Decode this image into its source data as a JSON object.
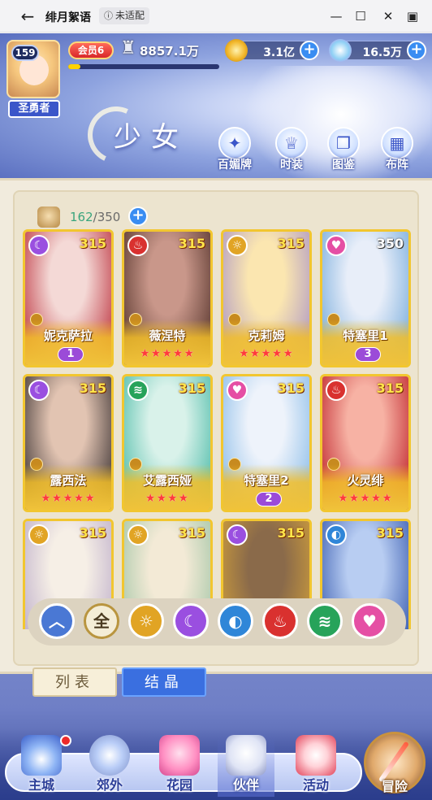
{
  "window": {
    "title": "绯月絮语",
    "badge": "未适配",
    "back_icon": "back-arrow-icon"
  },
  "player": {
    "level": "159",
    "title_tag": "圣勇者",
    "vip": "会员6",
    "power": "8857.1万",
    "exp_progress": 0.08
  },
  "resources": [
    {
      "name": "gold",
      "value": "3.1亿",
      "color": "#f2b72a"
    },
    {
      "name": "diamond",
      "value": "16.5万",
      "color": "#8fd0f5"
    }
  ],
  "banner": {
    "section_title": "少女",
    "functions": [
      {
        "label": "百媚牌",
        "icon": "card-icon"
      },
      {
        "label": "时装",
        "icon": "dress-icon"
      },
      {
        "label": "图鉴",
        "icon": "book-icon"
      },
      {
        "label": "布阵",
        "icon": "formation-icon"
      }
    ]
  },
  "roster": {
    "current": "162",
    "separator": "/",
    "max": "350"
  },
  "elements": {
    "moon": {
      "symbol": "☾",
      "color": "#9a4fe0"
    },
    "fire": {
      "symbol": "♨",
      "color": "#d9312f"
    },
    "sun": {
      "symbol": "☼",
      "color": "#e1a424"
    },
    "heart": {
      "symbol": "♥",
      "color": "#e54fa4"
    },
    "wind": {
      "symbol": "≋",
      "color": "#27a35a"
    },
    "water": {
      "symbol": "◐",
      "color": "#2f86d8"
    }
  },
  "cards": [
    {
      "name": "妮克萨拉",
      "power": "315",
      "element": "moon",
      "stars": "",
      "rank": "1",
      "art1": "#f4d9d6",
      "art2": "#b7222f"
    },
    {
      "name": "薇涅特",
      "power": "315",
      "element": "fire",
      "stars": "★★★★★",
      "rank": "",
      "art1": "#c9978a",
      "art2": "#4a2a22"
    },
    {
      "name": "克莉姆",
      "power": "315",
      "element": "sun",
      "stars": "★★★★★",
      "rank": "",
      "art1": "#fbe6b0",
      "art2": "#a48ec8"
    },
    {
      "name": "特塞里1",
      "power": "350",
      "element": "heart",
      "stars": "",
      "rank": "3",
      "art1": "#e8eef9",
      "art2": "#6aa4d8"
    },
    {
      "name": "露西法",
      "power": "315",
      "element": "moon",
      "stars": "★★★★★",
      "rank": "",
      "art1": "#e2c4b2",
      "art2": "#2b2426"
    },
    {
      "name": "艾露西娅",
      "power": "315",
      "element": "wind",
      "stars": "★★★★",
      "rank": "",
      "art1": "#d9f2ea",
      "art2": "#3fb6a2"
    },
    {
      "name": "特塞里2",
      "power": "315",
      "element": "heart",
      "stars": "",
      "rank": "2",
      "art1": "#eef3fb",
      "art2": "#7fb6e6"
    },
    {
      "name": "火灵绯",
      "power": "315",
      "element": "fire",
      "stars": "★★★★★",
      "rank": "",
      "art1": "#f7b2a4",
      "art2": "#b9141e"
    },
    {
      "name": "",
      "power": "315",
      "element": "sun",
      "stars": "",
      "rank": "",
      "art1": "#f6efe6",
      "art2": "#b9a9c8"
    },
    {
      "name": "",
      "power": "315",
      "element": "sun",
      "stars": "",
      "rank": "",
      "art1": "#f3ead6",
      "art2": "#9bc2a2"
    },
    {
      "name": "",
      "power": "315",
      "element": "moon",
      "stars": "",
      "rank": "",
      "art1": "#8a6a4a",
      "art2": "#d8a53a"
    },
    {
      "name": "",
      "power": "315",
      "element": "water",
      "stars": "",
      "rank": "",
      "art1": "#b8cdf2",
      "art2": "#2b4fa8"
    }
  ],
  "filters": [
    {
      "label": "",
      "icon": "chevron-up-icon",
      "color": "#4a78d4"
    },
    {
      "label": "全",
      "icon": "all-icon",
      "color": "#f4edd6"
    },
    {
      "label": "",
      "icon": "sun-filter-icon",
      "color": "#e1a424"
    },
    {
      "label": "",
      "icon": "moon-filter-icon",
      "color": "#9a4fe0"
    },
    {
      "label": "",
      "icon": "water-filter-icon",
      "color": "#2f86d8"
    },
    {
      "label": "",
      "icon": "fire-filter-icon",
      "color": "#d9312f"
    },
    {
      "label": "",
      "icon": "wind-filter-icon",
      "color": "#27a35a"
    },
    {
      "label": "",
      "icon": "heart-filter-icon",
      "color": "#e54fa4"
    }
  ],
  "tabs": [
    {
      "label": "列表",
      "active": true
    },
    {
      "label": "结晶",
      "active": false
    }
  ],
  "nav": [
    {
      "label": "主城",
      "icon": "castle-icon",
      "badge": true
    },
    {
      "label": "郊外",
      "icon": "portal-icon",
      "badge": false
    },
    {
      "label": "花园",
      "icon": "heart-garden-icon",
      "badge": false
    },
    {
      "label": "伙伴",
      "icon": "partner-icon",
      "badge": false,
      "active": true
    },
    {
      "label": "活动",
      "icon": "gift-icon",
      "badge": false
    }
  ],
  "adventure": {
    "label": "冒险",
    "icon": "compass-icon"
  }
}
